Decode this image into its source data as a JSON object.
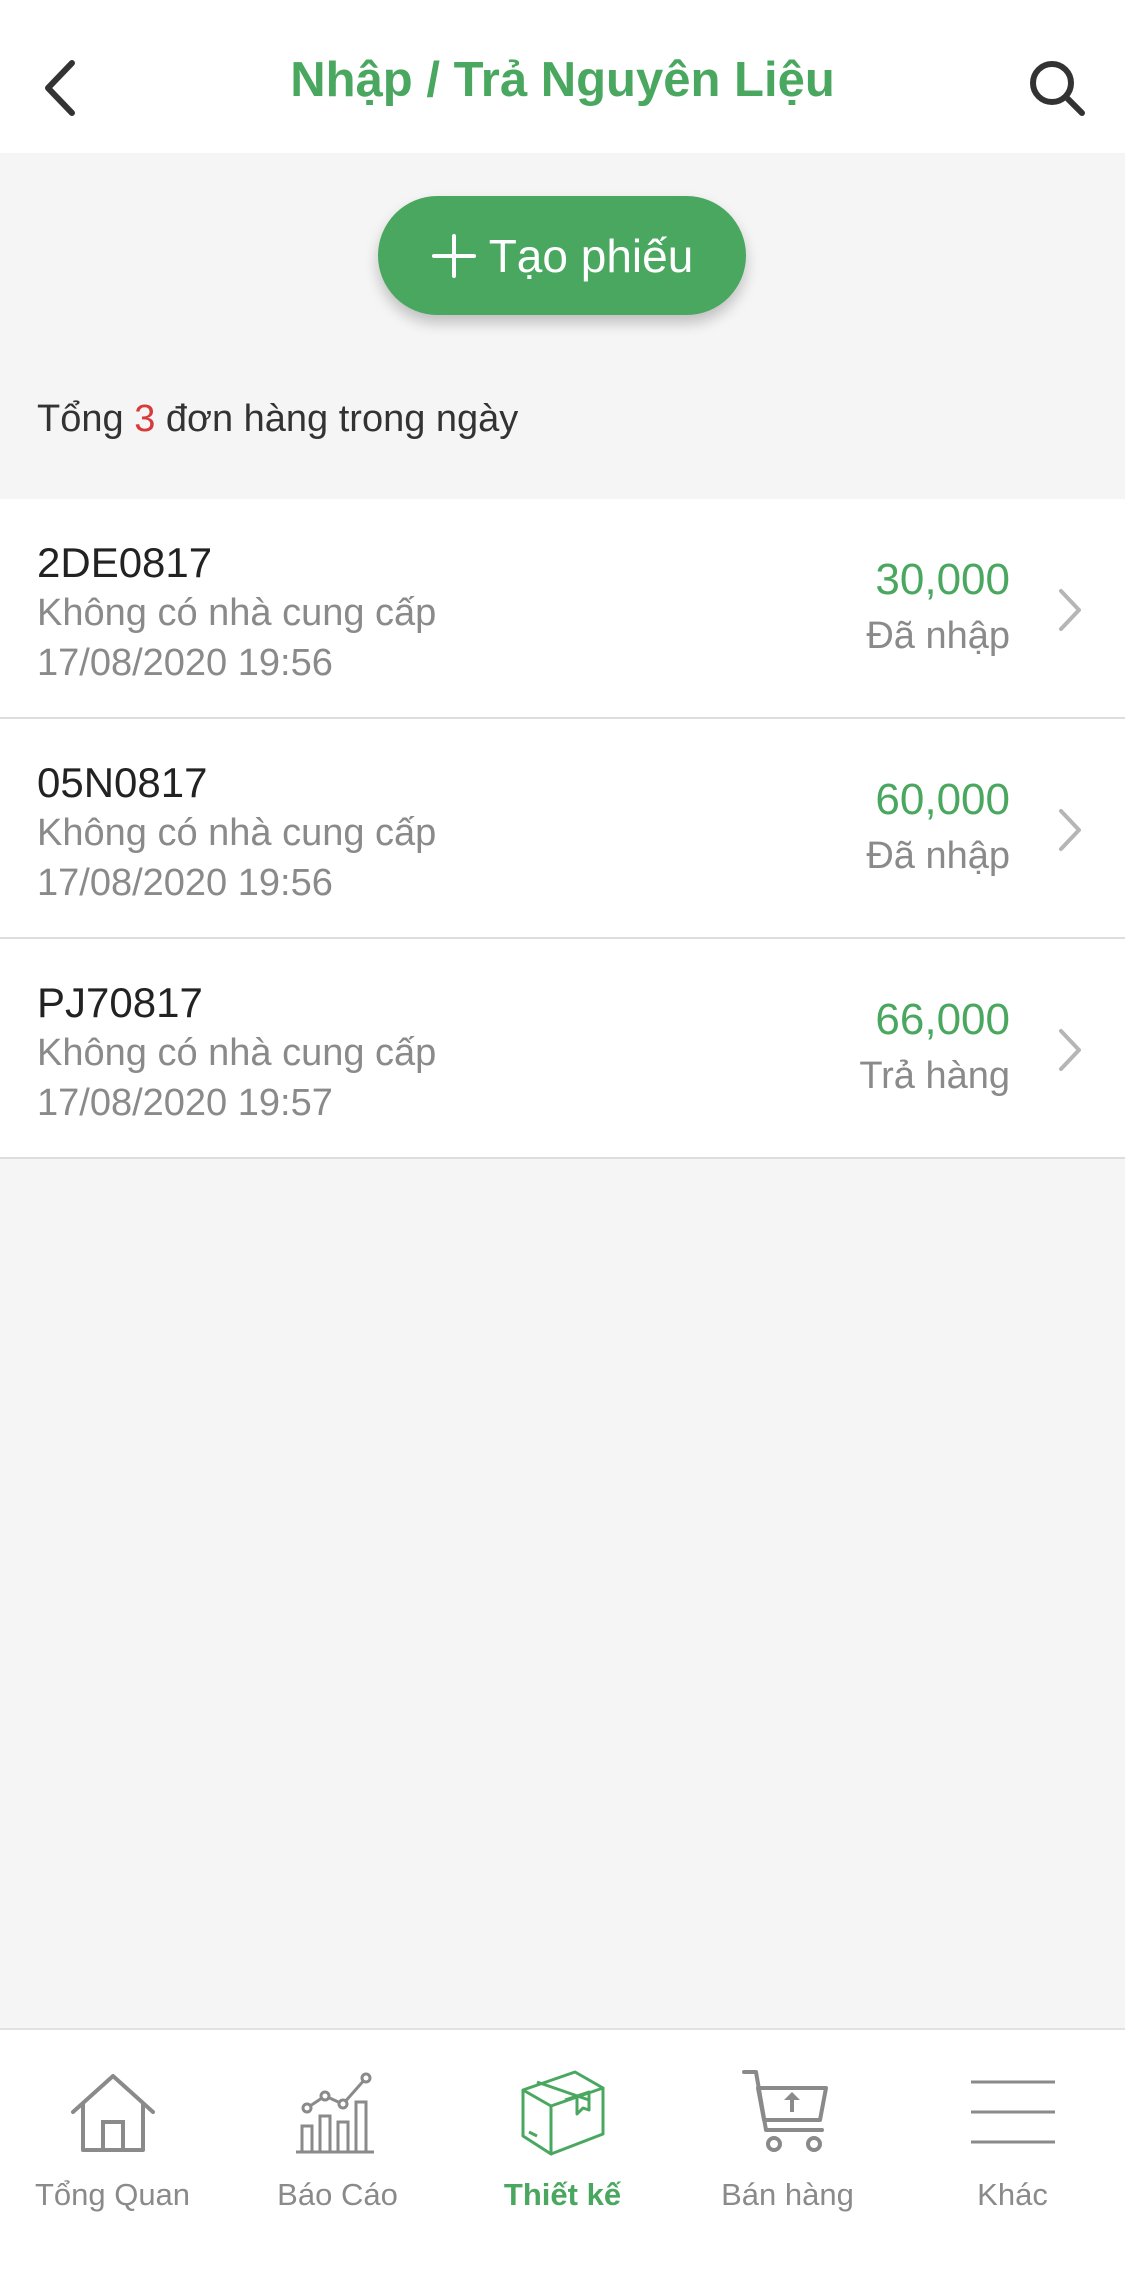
{
  "header": {
    "title": "Nhập / Trả Nguyên Liệu",
    "back_icon": "chevron-left-icon",
    "search_icon": "search-icon"
  },
  "create_button": {
    "label": "Tạo phiếu",
    "icon": "plus-icon"
  },
  "summary": {
    "prefix": "Tổng",
    "count": "3",
    "suffix": "đơn hàng trong ngày",
    "count_color": "#d83a3a"
  },
  "orders": [
    {
      "code": "2DE0817",
      "supplier": "Không có nhà cung cấp",
      "datetime": "17/08/2020 19:56",
      "amount": "30,000",
      "status": "Đã nhập"
    },
    {
      "code": "05N0817",
      "supplier": "Không có nhà cung cấp",
      "datetime": "17/08/2020 19:56",
      "amount": "60,000",
      "status": "Đã nhập"
    },
    {
      "code": "PJ70817",
      "supplier": "Không có nhà cung cấp",
      "datetime": "17/08/2020 19:57",
      "amount": "66,000",
      "status": "Trả hàng"
    }
  ],
  "bottom_nav": {
    "items": [
      {
        "label": "Tổng Quan",
        "icon": "home-icon",
        "active": false
      },
      {
        "label": "Báo Cáo",
        "icon": "chart-icon",
        "active": false
      },
      {
        "label": "Thiết kế",
        "icon": "box-icon",
        "active": true
      },
      {
        "label": "Bán hàng",
        "icon": "cart-icon",
        "active": false
      },
      {
        "label": "Khác",
        "icon": "menu-icon",
        "active": false
      }
    ]
  },
  "colors": {
    "accent": "#4aa760",
    "background": "#f5f5f5",
    "text_muted": "#8a8a8a"
  }
}
